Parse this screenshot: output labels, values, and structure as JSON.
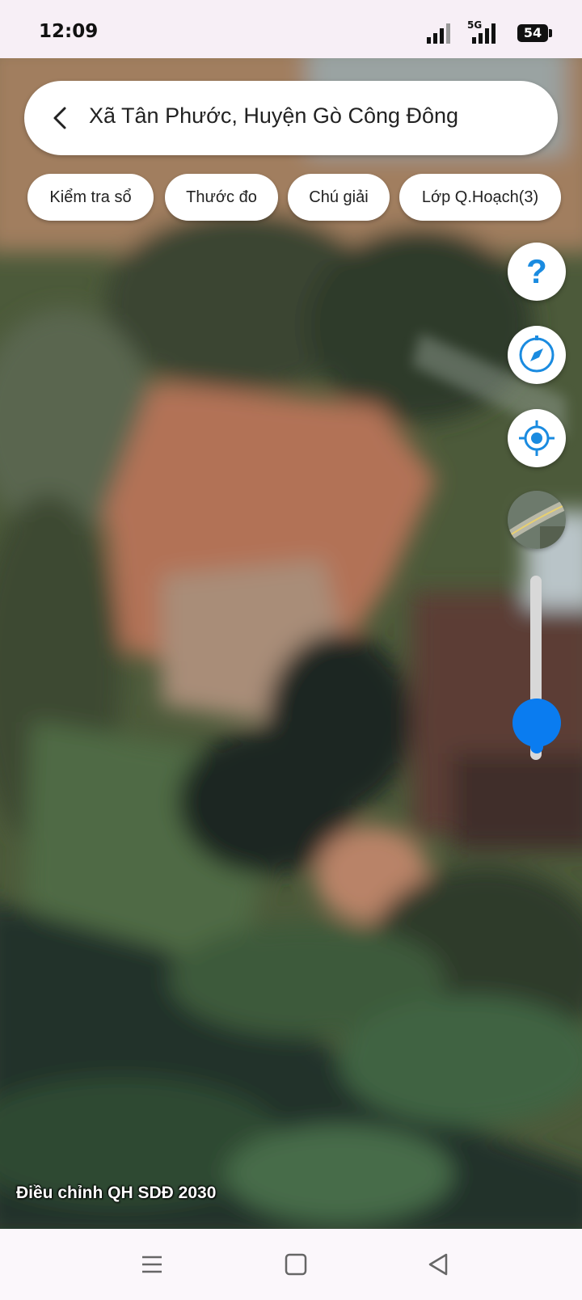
{
  "status_bar": {
    "time": "12:09",
    "network": "5G",
    "battery": "54"
  },
  "search": {
    "title": "Xã Tân Phước, Huyện Gò Công Đông"
  },
  "chips": [
    {
      "label": "Kiểm tra sổ"
    },
    {
      "label": "Thước đo"
    },
    {
      "label": "Chú giải"
    },
    {
      "label": "Lớp Q.Hoạch(3)"
    }
  ],
  "map_controls": {
    "help_icon": "question-mark-icon",
    "compass_icon": "compass-icon",
    "locate_icon": "gps-locate-icon",
    "opacity_level": 0.2
  },
  "map": {
    "layer_label": "Điều chỉnh QH SDĐ 2030"
  },
  "nav_bar": {
    "menu_icon": "recent-apps-icon",
    "home_icon": "home-icon",
    "back_icon": "back-icon"
  },
  "colors": {
    "accent": "#1a8be0",
    "slider": "#0a7cf0"
  }
}
